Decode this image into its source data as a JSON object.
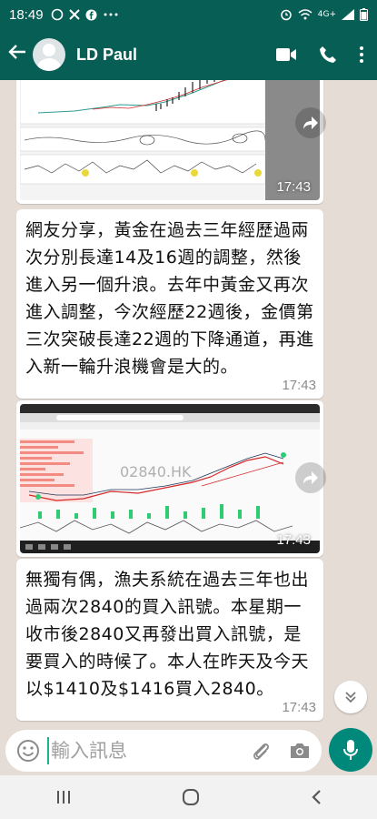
{
  "status_bar": {
    "time": "18:49",
    "left_icons": [
      "whatsapp-icon",
      "x-icon",
      "facebook-icon",
      "more-icon"
    ],
    "right_icons": [
      "alarm-icon",
      "wifi-icon",
      "signal-icon",
      "battery-icon"
    ],
    "network": "4G+"
  },
  "header": {
    "contact_name": "LD Paul",
    "actions": [
      "video-call-icon",
      "voice-call-icon",
      "more-options-icon"
    ]
  },
  "messages": [
    {
      "type": "image",
      "time": "17:43",
      "caption": ""
    },
    {
      "type": "text",
      "text": "網友分享，黃金在過去三年經歷過兩次分別長達14及16週的調整，然後進入另一個升浪。去年中黃金又再次進入調整，今次經歷22週後，金價第三次突破長達22週的下降通道，再進入新一輪升浪機會是大的。",
      "time": "17:43"
    },
    {
      "type": "image",
      "time": "17:43",
      "watermark": "02840.HK"
    },
    {
      "type": "text",
      "text": "無獨有偶，漁夫系統在過去三年也出過兩次2840的買入訊號。本星期一收市後2840又再發出買入訊號，是要買入的時候了。本人在昨天及今天以$1410及$1416買入2840。",
      "time": "17:43"
    }
  ],
  "composer": {
    "placeholder": "輸入訊息"
  },
  "colors": {
    "header": "#075e54",
    "background": "#e5ddd5",
    "accent": "#00897b"
  }
}
